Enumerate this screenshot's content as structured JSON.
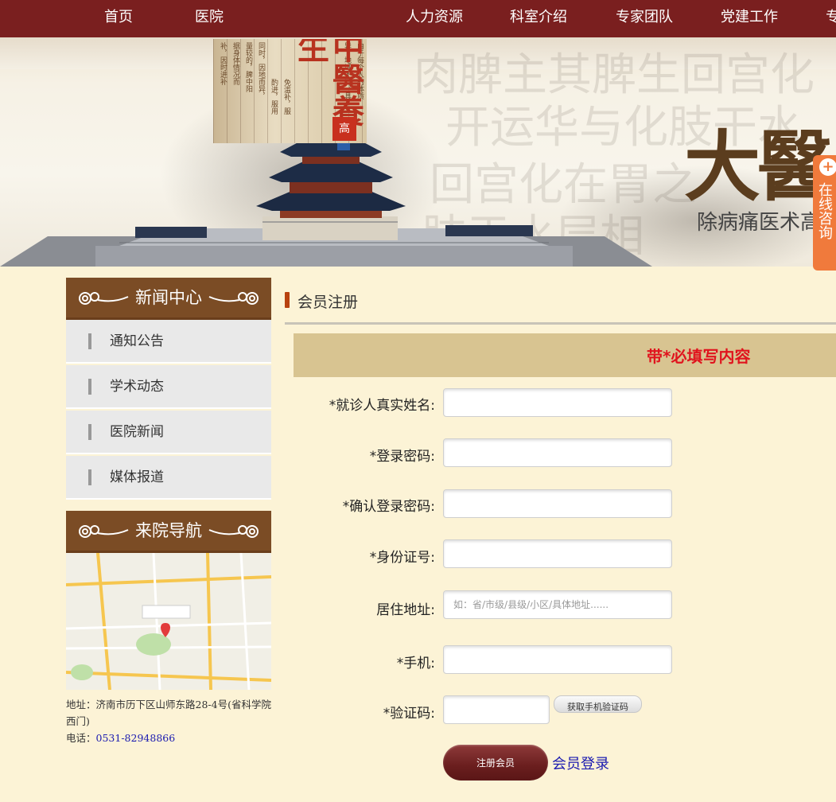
{
  "nav": {
    "items": [
      "首页",
      "医院",
      "人力资源",
      "科室介绍",
      "专家团队",
      "党建工作",
      "专"
    ]
  },
  "banner": {
    "title": "大醫",
    "subtitle": "除病痛医术高",
    "calligraphy": [
      "肉脾主其脾生回宫化",
      "开运华与化肢干水",
      "回宫化在胃之",
      "肢于水层相"
    ],
    "poster": {
      "headline": "中醫養生",
      "seal": "高",
      "text_columns": [
        "由于每个人的体质",
        "异，地域不同，具",
        "同时，因地而异，",
        "量较的，脾中阳",
        "据身体情况而",
        "补，因时进补",
        "酌进，服用",
        "免滥补，服"
      ]
    },
    "consult": {
      "icon": "plus-circle-icon",
      "label": "在线咨询"
    }
  },
  "sidebar": {
    "news_title": "新闻中心",
    "news_items": [
      "通知公告",
      "学术动态",
      "医院新闻",
      "媒体报道"
    ],
    "nav_title": "来院导航",
    "address": "地址：济南市历下区山师东路28-4号(省科学院西门)",
    "phone_label": "电话：",
    "phone": "0531-82948866"
  },
  "main": {
    "section_title": "会员注册",
    "required_notice": "带*必填写内容",
    "fields": [
      {
        "label": "*就诊人真实姓名:",
        "value": "",
        "placeholder": ""
      },
      {
        "label": "*登录密码:",
        "value": "",
        "placeholder": ""
      },
      {
        "label": "*确认登录密码:",
        "value": "",
        "placeholder": ""
      },
      {
        "label": "*身份证号:",
        "value": "",
        "placeholder": ""
      },
      {
        "label": "居住地址:",
        "value": "",
        "placeholder": "如：省/市级/县级/小区/具体地址......"
      },
      {
        "label": "*手机:",
        "value": "",
        "placeholder": ""
      },
      {
        "label": "*验证码:",
        "value": "",
        "placeholder": ""
      }
    ],
    "sms_button": "获取手机验证码",
    "register_button": "注册会员",
    "login_link": "会员登录"
  },
  "colors": {
    "nav_bg": "#7a1f1f",
    "page_bg": "#fcf3d6",
    "sidebar_head": "#7b4c25",
    "notice_bg": "#d8c491",
    "notice_text": "#e0141e",
    "link": "#1a1ab0",
    "consult_tab": "#f07a3c"
  }
}
